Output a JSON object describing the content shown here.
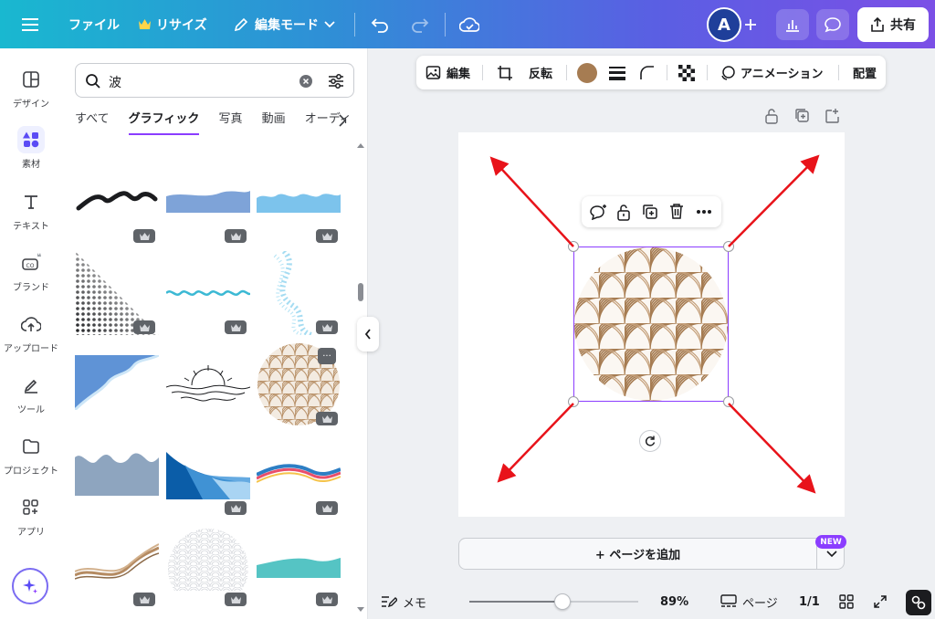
{
  "topbar": {
    "file_label": "ファイル",
    "resize_label": "リサイズ",
    "edit_mode_label": "編集モード",
    "avatar_initial": "A",
    "share_label": "共有"
  },
  "rail": {
    "items": [
      {
        "label": "デザイン",
        "icon": "layout-icon"
      },
      {
        "label": "素材",
        "icon": "elements-icon"
      },
      {
        "label": "テキスト",
        "icon": "text-icon"
      },
      {
        "label": "ブランド",
        "icon": "brand-icon"
      },
      {
        "label": "アップロード",
        "icon": "upload-icon"
      },
      {
        "label": "ツール",
        "icon": "draw-icon"
      },
      {
        "label": "プロジェクト",
        "icon": "folder-icon"
      },
      {
        "label": "アプリ",
        "icon": "apps-icon"
      }
    ]
  },
  "panel": {
    "search_value": "波",
    "tabs": [
      "すべて",
      "グラフィック",
      "写真",
      "動画",
      "オーディ"
    ],
    "active_tab": "グラフィック"
  },
  "context_toolbar": {
    "edit_label": "編集",
    "flip_label": "反転",
    "color": "#a67c52",
    "animation_label": "アニメーション",
    "position_label": "配置"
  },
  "canvas": {
    "add_page_label": "+ ページを追加",
    "new_badge": "NEW",
    "arrow_color": "#e8131a",
    "pattern_color": "#a67c52",
    "selection_color": "#8b3dff"
  },
  "bottombar": {
    "notes_label": "メモ",
    "zoom_label": "89%",
    "zoom_level": 0.55,
    "pages_label": "ページ",
    "page_count": "1/1"
  }
}
